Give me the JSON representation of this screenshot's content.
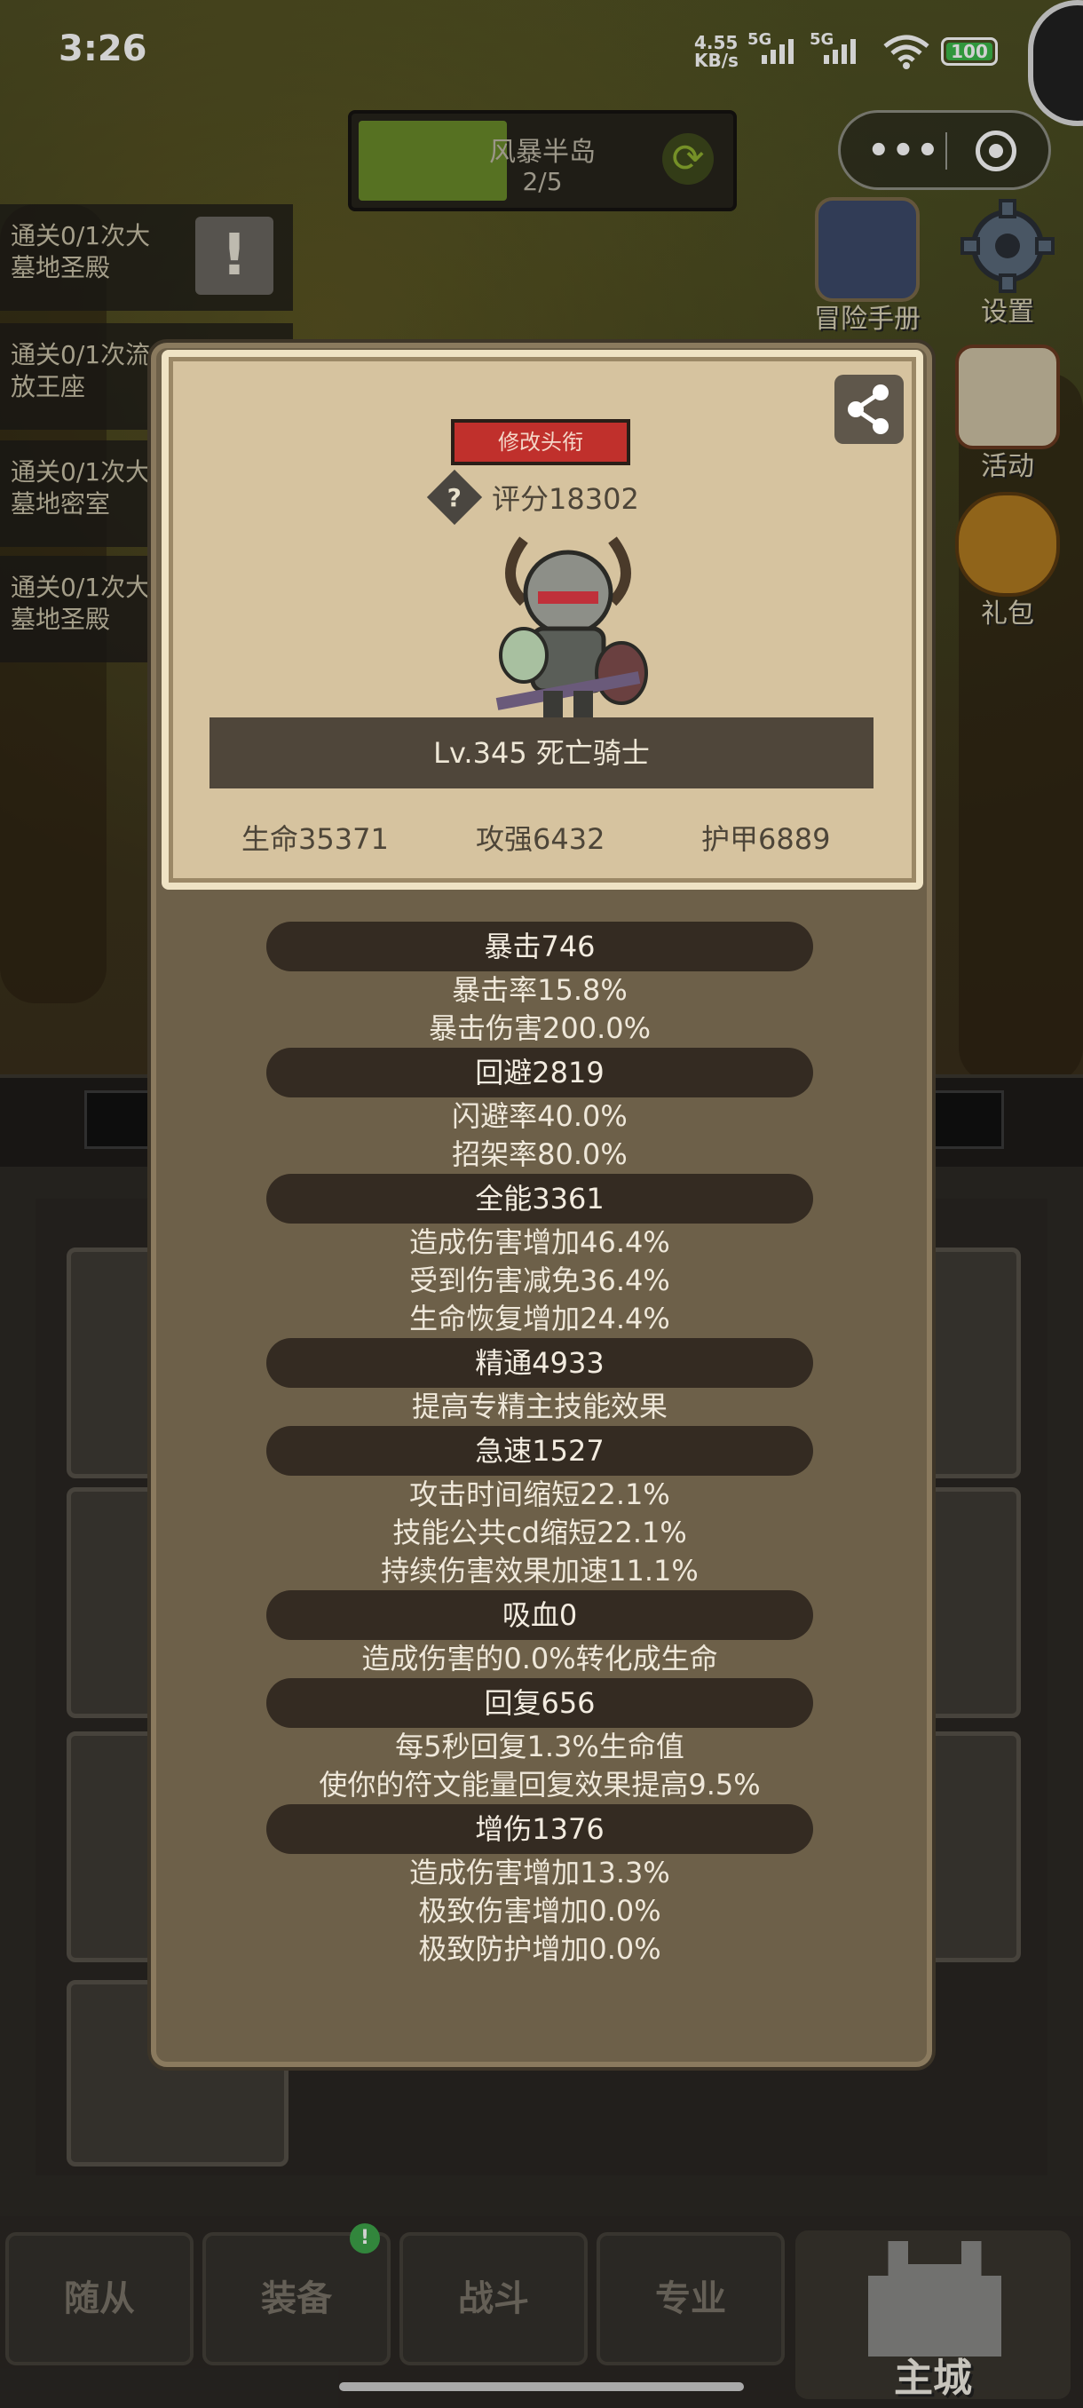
{
  "status_bar": {
    "time": "3:26",
    "net_speed_top": "4.55",
    "net_speed_bottom": "KB/s",
    "sim1": "5G",
    "sim2": "5G",
    "battery": "100"
  },
  "hud": {
    "stage_name": "风暴半岛",
    "stage_progress": "2/5",
    "stage_progress_fraction": 0.4
  },
  "side_buttons": [
    {
      "label": "冒险手册",
      "icon": "book-icon"
    },
    {
      "label": "设置",
      "icon": "gear-icon"
    },
    {
      "label": "活动",
      "icon": "scroll-icon"
    },
    {
      "label": "礼包",
      "icon": "gift-coin-icon"
    }
  ],
  "quests": [
    {
      "line1": "通关0/1次大",
      "line2": "墓地圣殿",
      "badge": "!"
    },
    {
      "line1": "通关0/1次流",
      "line2": "放王座"
    },
    {
      "line1": "通关0/1次大",
      "line2": "墓地密室"
    },
    {
      "line1": "通关0/1次大",
      "line2": "墓地圣殿"
    }
  ],
  "profile": {
    "edit_title_label": "修改头衔",
    "score_text": "评分18302",
    "help_glyph": "?",
    "level_name": "Lv.345 死亡骑士",
    "hp_text": "生命35371",
    "attack_text": "攻强6432",
    "armor_text": "护甲6889"
  },
  "stats": [
    {
      "head": "暴击746",
      "lines": [
        "暴击率15.8%",
        "暴击伤害200.0%"
      ]
    },
    {
      "head": "回避2819",
      "lines": [
        "闪避率40.0%",
        "招架率80.0%"
      ]
    },
    {
      "head": "全能3361",
      "lines": [
        "造成伤害增加46.4%",
        "受到伤害减免36.4%",
        "生命恢复增加24.4%"
      ]
    },
    {
      "head": "精通4933",
      "lines": [
        "提高专精主技能效果"
      ]
    },
    {
      "head": "急速1527",
      "lines": [
        "攻击时间缩短22.1%",
        "技能公共cd缩短22.1%",
        "持续伤害效果加速11.1%"
      ]
    },
    {
      "head": "吸血0",
      "lines": [
        "造成伤害的0.0%转化成生命"
      ]
    },
    {
      "head": "回复656",
      "lines": [
        "每5秒回复1.3%生命值",
        "使你的符文能量回复效果提高9.5%"
      ]
    },
    {
      "head": "增伤1376",
      "lines": [
        "造成伤害增加13.3%",
        "极致伤害增加0.0%",
        "极致防护增加0.0%"
      ]
    }
  ],
  "tabs": {
    "followers": "随从",
    "equipment": "装备",
    "battle": "战斗",
    "profession": "专业",
    "main_city": "主城",
    "equipment_badge": "!"
  },
  "colors": {
    "title_button": "#c0302c",
    "card": "#d6c39f",
    "stat_pill": "#342b22",
    "modal": "#6d6049"
  }
}
